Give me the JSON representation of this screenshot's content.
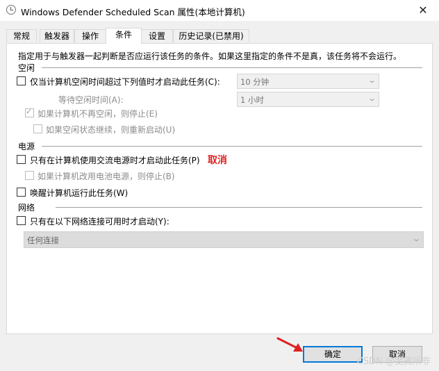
{
  "window": {
    "title": "Windows Defender Scheduled Scan 属性(本地计算机)",
    "close_glyph": "✕"
  },
  "tabs": [
    "常规",
    "触发器",
    "操作",
    "条件",
    "设置",
    "历史记录(已禁用)"
  ],
  "active_tab": "条件",
  "description": "指定用于与触发器一起判断是否应运行该任务的条件。如果这里指定的条件不是真，该任务将不会运行。",
  "idle": {
    "section_label": "空闲",
    "start_only_if_idle": {
      "label": "仅当计算机空闲时间超过下列值时才启动此任务(C):",
      "checked": false
    },
    "idle_duration": "10 分钟",
    "wait_for_idle_label": "等待空闲时间(A):",
    "wait_for_idle": "1 小时",
    "stop_if_not_idle": {
      "label": "如果计算机不再空闲，则停止(E)",
      "checked": true
    },
    "restart_if_idle_resumes": {
      "label": "如果空闲状态继续，则重新启动(U)",
      "checked": false
    }
  },
  "power": {
    "section_label": "电源",
    "start_only_on_ac": {
      "label": "只有在计算机使用交流电源时才启动此任务(P)",
      "checked": false
    },
    "annotation": "取消",
    "stop_on_battery": {
      "label": "如果计算机改用电池电源，则停止(B)",
      "checked": false
    },
    "wake_to_run": {
      "label": "唤醒计算机运行此任务(W)",
      "checked": false
    }
  },
  "network": {
    "section_label": "网络",
    "start_only_if_network": {
      "label": "只有在以下网络连接可用时才启动(Y):",
      "checked": false
    },
    "connection": "任何连接"
  },
  "buttons": {
    "ok": "确定",
    "cancel": "取消"
  },
  "watermark": "CSDN @斐夷所非",
  "colors": {
    "annotation": "#e02020",
    "arrow": "#e02020",
    "focus": "#0078d7"
  }
}
